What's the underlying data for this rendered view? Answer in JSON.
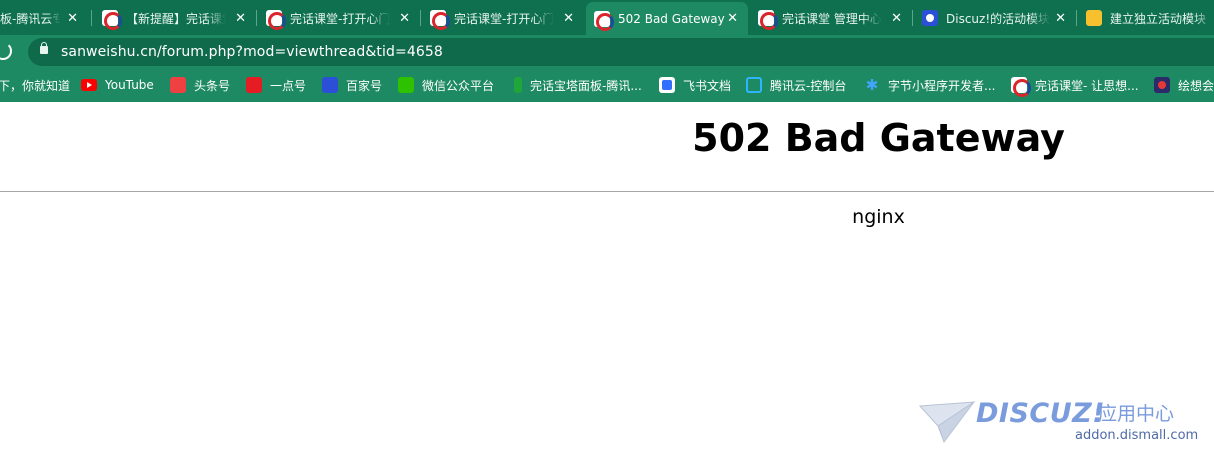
{
  "tabs": [
    {
      "title": "板-腾讯云专",
      "favicon": "blank-icon",
      "active": false
    },
    {
      "title": "【新提醒】完话课堂",
      "favicon": "wanhua-logo-icon",
      "active": false
    },
    {
      "title": "完话课堂-打开心门",
      "favicon": "wanhua-logo-icon",
      "active": false
    },
    {
      "title": "完话课堂-打开心门",
      "favicon": "wanhua-logo-icon",
      "active": false
    },
    {
      "title": "502 Bad Gateway",
      "favicon": "wanhua-logo-icon",
      "active": true
    },
    {
      "title": "完话课堂 管理中心",
      "favicon": "wanhua-logo-icon",
      "active": false
    },
    {
      "title": "Discuz!的活动模块",
      "favicon": "baidu-paw-icon",
      "active": false
    },
    {
      "title": "建立独立活动模块",
      "favicon": "note-icon",
      "active": false
    }
  ],
  "tab_close_glyph": "✕",
  "address": {
    "url": "sanweishu.cn/forum.php?mod=viewthread&tid=4658"
  },
  "bookmarks": [
    {
      "label": "下，你就知道",
      "icon": ""
    },
    {
      "label": "YouTube",
      "icon": "youtube-icon"
    },
    {
      "label": "头条号",
      "icon": "toutiao-icon"
    },
    {
      "label": "一点号",
      "icon": "yidian-icon"
    },
    {
      "label": "百家号",
      "icon": "baidu-paw-icon"
    },
    {
      "label": "微信公众平台",
      "icon": "wechat-icon"
    },
    {
      "label": "完话宝塔面板-腾讯...",
      "icon": "bt-panel-icon"
    },
    {
      "label": "飞书文档",
      "icon": "feishu-icon"
    },
    {
      "label": "腾讯云-控制台",
      "icon": "tencent-cloud-icon"
    },
    {
      "label": "字节小程序开发者...",
      "icon": "bytedance-icon"
    },
    {
      "label": "完话课堂- 让思想...",
      "icon": "wanhua-logo-icon"
    },
    {
      "label": "绘想会",
      "icon": "huixiang-icon"
    }
  ],
  "page": {
    "heading": "502 Bad Gateway",
    "server": "nginx"
  },
  "watermark": {
    "brand": "DISCUZ!",
    "subtitle": "应用中心",
    "domain": "addon.dismall.com",
    "color": "#7a9bdc"
  },
  "colors": {
    "tab_strip": "#0f7050",
    "toolbar": "#1d8a63",
    "omnibox": "#0f6a4b"
  }
}
